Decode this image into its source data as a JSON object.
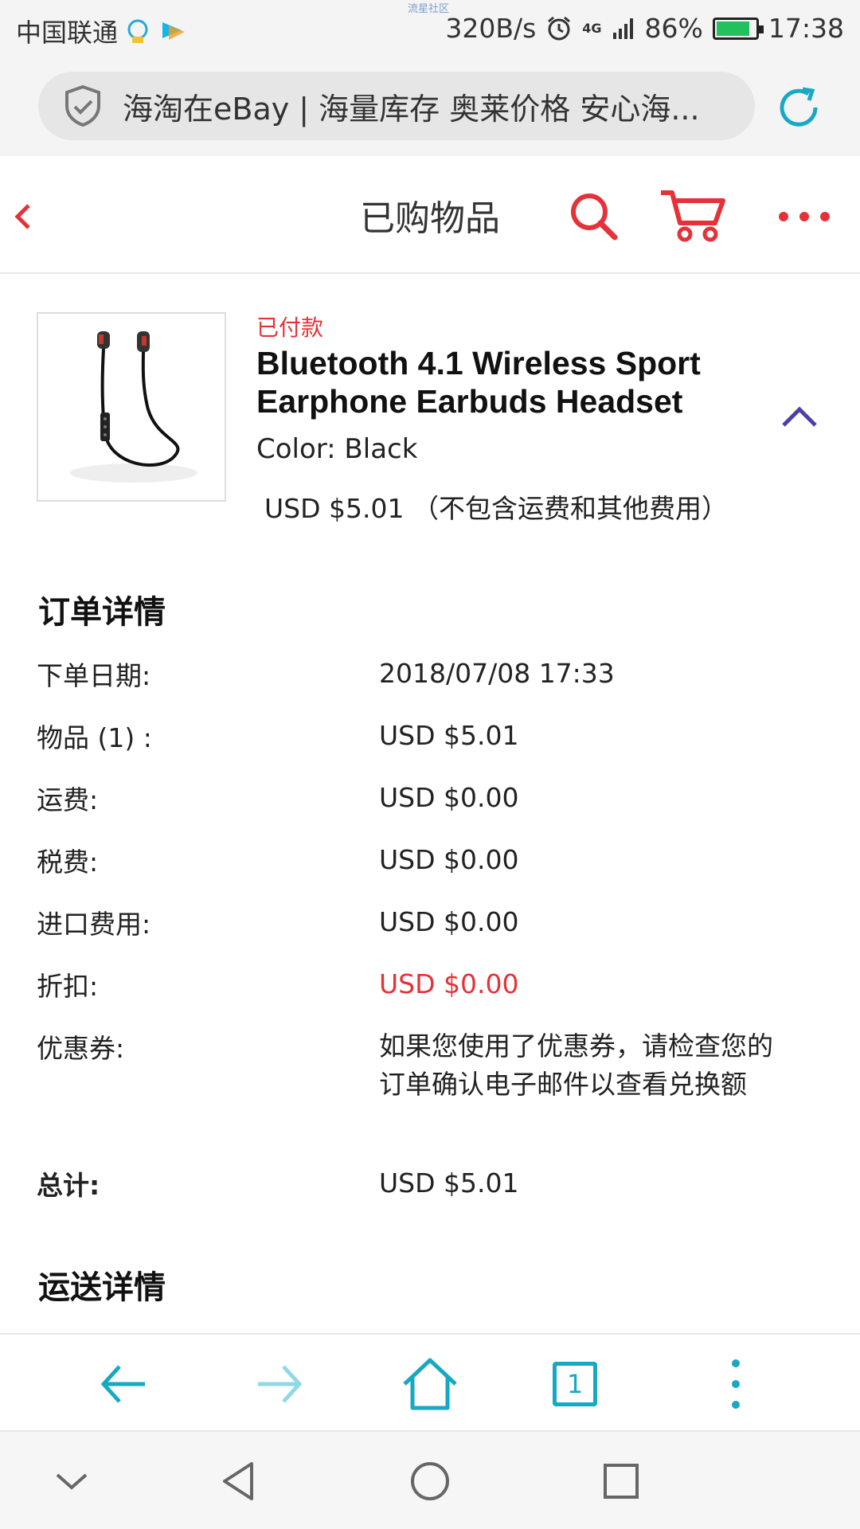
{
  "status_bar": {
    "carrier": "中国联通",
    "tiny_label": "流星社区",
    "net_speed": "320B/s",
    "network_type": "4G",
    "battery": "86%",
    "battery_level": 0.86,
    "time": "17:38"
  },
  "url_bar": {
    "url_text": "海淘在eBay | 海量库存 奥莱价格 安心海...",
    "shield_icon": "shield-check-icon",
    "refresh_icon": "refresh-icon"
  },
  "header": {
    "title": "已购物品",
    "back_icon": "chevron-left-icon",
    "search_icon": "search-icon",
    "cart_icon": "cart-icon",
    "more_icon": "more-horizontal-icon"
  },
  "product": {
    "status": "已付款",
    "title": "Bluetooth 4.1 Wireless Sport Earphone Earbuds Headset",
    "color": "Color: Black",
    "price": "USD $5.01 （不包含运费和其他费用）",
    "image_icon": "earphone-image"
  },
  "order_details": {
    "title": "订单详情",
    "rows": [
      {
        "label": "下单日期:",
        "value": "2018/07/08 17:33"
      },
      {
        "label": "物品 (1) :",
        "value": "USD $5.01"
      },
      {
        "label": "运费:",
        "value": "USD $0.00"
      },
      {
        "label": "税费:",
        "value": "USD $0.00"
      },
      {
        "label": "进口费用:",
        "value": "USD $0.00"
      },
      {
        "label": "折扣:",
        "value": "USD $0.00"
      },
      {
        "label": "优惠券:",
        "value": "如果您使用了优惠券，请检查您的订单确认电子邮件以查看兑换额"
      },
      {
        "label": "总计:",
        "value": "USD $5.01"
      }
    ]
  },
  "shipping_details": {
    "title": "运送详情"
  },
  "toolbar": {
    "tab_count": "1",
    "back_icon": "arrow-left-icon",
    "forward_icon": "arrow-right-icon",
    "home_icon": "home-icon",
    "menu_icon": "more-vertical-icon"
  },
  "colors": {
    "ebay_red": "#e53238",
    "teal": "#17a8c4",
    "chevron_purple": "#4b3fa8"
  }
}
